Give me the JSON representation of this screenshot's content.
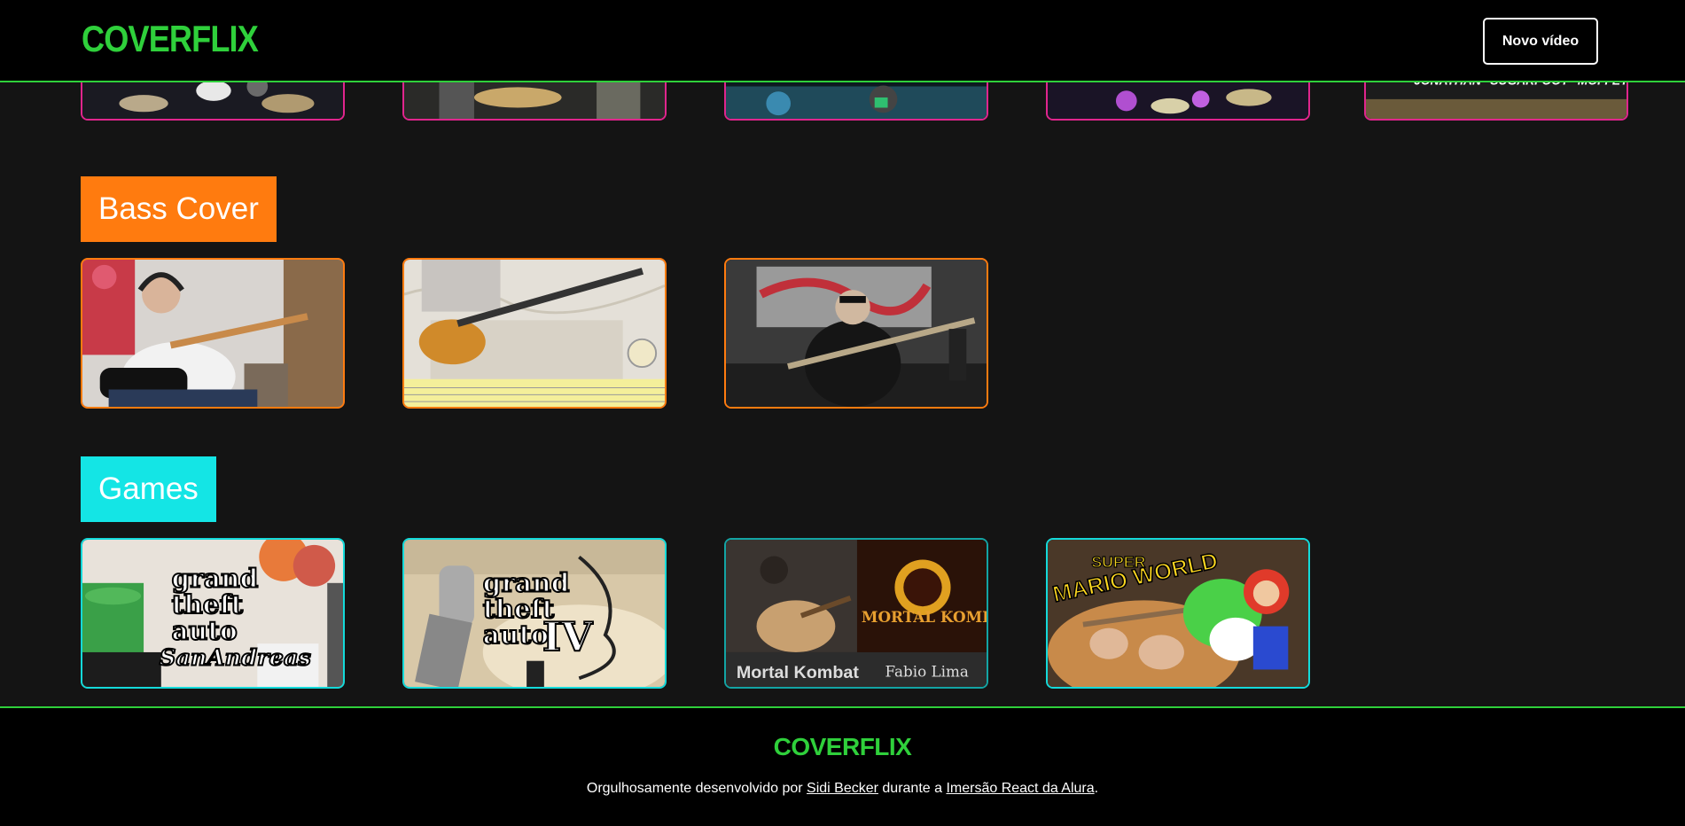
{
  "header": {
    "logo": "COVERFLIX",
    "new_video_label": "Novo vídeo"
  },
  "top_row": {
    "overlay_text": "JONATHAN \"SUGARFOOT\" MOFFETT",
    "accent": "#e0258d"
  },
  "categories": [
    {
      "title": "Bass Cover",
      "color": "#ff7b0f",
      "video_count": 3
    },
    {
      "title": "Games",
      "color": "#14e5e5",
      "video_count": 4
    }
  ],
  "games": {
    "thumb1_lines": [
      "grand",
      "theft",
      "auto",
      "SanAndreas"
    ],
    "thumb2_lines": [
      "grand",
      "theft",
      "auto",
      "IV"
    ],
    "thumb3_left": "Mortal Kombat",
    "thumb3_right": "Fabio Lima",
    "thumb3_logo": "MORTAL KOMBAT",
    "thumb4_title_top": "SUPER",
    "thumb4_title_bottom": "MARIO WORLD"
  },
  "footer": {
    "logo": "COVERFLIX",
    "prefix": "Orgulhosamente desenvolvido por ",
    "author": "Sidi Becker",
    "middle": " durante a ",
    "event": "Imersão React da Alura",
    "suffix": "."
  },
  "colors": {
    "brand": "#2fd03b",
    "background": "#141414"
  }
}
